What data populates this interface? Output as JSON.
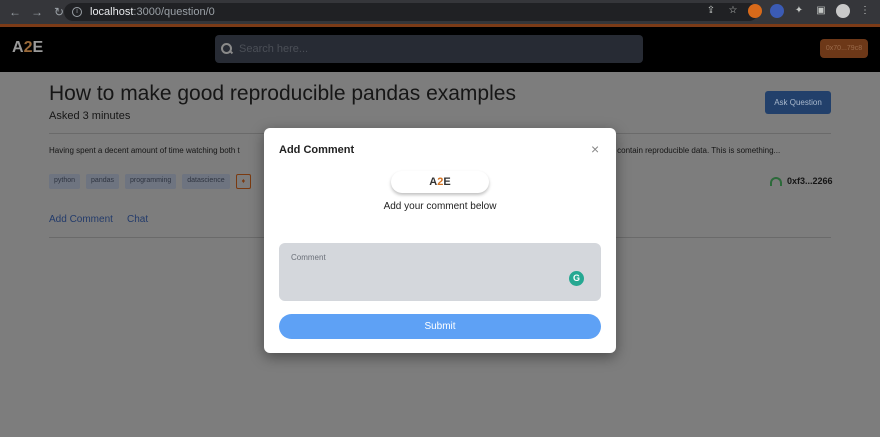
{
  "browser": {
    "url_host": "localhost",
    "url_path": ":3000/question/0"
  },
  "header": {
    "logo_left": "A",
    "logo_two": "2",
    "logo_right": "E",
    "search_placeholder": "Search here...",
    "wallet_label": "0x70...79c8"
  },
  "question": {
    "title": "How to make good reproducible pandas examples",
    "asked": "Asked 3 minutes",
    "ask_button": "Ask Question",
    "body_left": "Having spent a decent amount of time watching both t",
    "body_right": "kely to contain reproducible data. This is something...",
    "tags": [
      "python",
      "pandas",
      "programming",
      "datascience"
    ],
    "eth_tag": "♦",
    "author": "0xf3...2266",
    "tabs": [
      "Add Comment",
      "Chat"
    ]
  },
  "modal": {
    "title": "Add Comment",
    "close": "×",
    "logo_left": "A",
    "logo_two": "2",
    "logo_right": "E",
    "subtitle": "Add your comment below",
    "comment_placeholder": "Comment",
    "grammarly": "G",
    "submit": "Submit"
  },
  "colors": {
    "submit": "#5ea1f5",
    "wallet": "#c45d1c",
    "ask_button": "#3b6fd4"
  }
}
